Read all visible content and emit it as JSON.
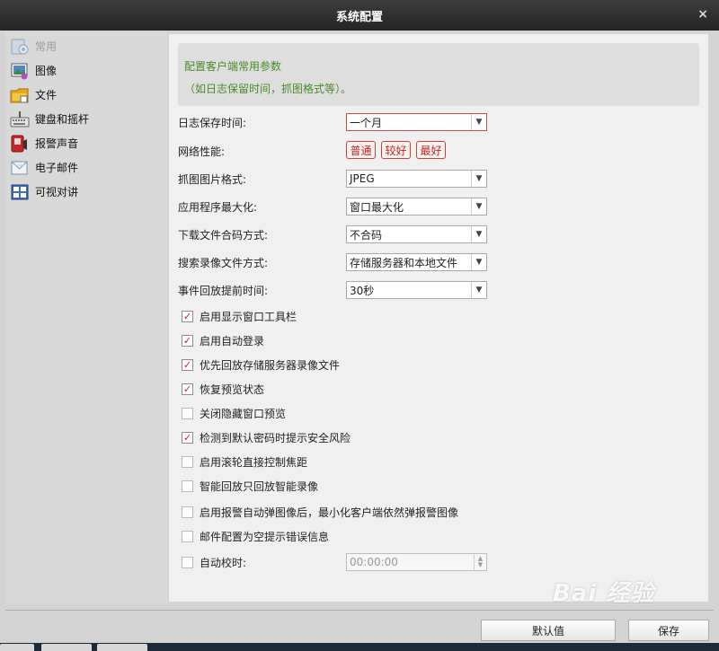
{
  "window": {
    "title": "系统配置",
    "close_icon": "×"
  },
  "sidebar": {
    "items": [
      {
        "label": "常用",
        "icon": "settings-icon",
        "active": true
      },
      {
        "label": "图像",
        "icon": "image-icon"
      },
      {
        "label": "文件",
        "icon": "folder-icon"
      },
      {
        "label": "键盘和摇杆",
        "icon": "keyboard-icon"
      },
      {
        "label": "报警声音",
        "icon": "alarm-sound-icon"
      },
      {
        "label": "电子邮件",
        "icon": "email-icon"
      },
      {
        "label": "可视对讲",
        "icon": "intercom-icon"
      }
    ]
  },
  "info": {
    "line1": "配置客户端常用参数",
    "line2": "（如日志保留时间，抓图格式等）。"
  },
  "settings": {
    "log_retention": {
      "label": "日志保存时间:",
      "value": "一个月"
    },
    "network": {
      "label": "网络性能:",
      "options": [
        "普通",
        "较好",
        "最好"
      ]
    },
    "capture_format": {
      "label": "抓图图片格式:",
      "value": "JPEG"
    },
    "app_maximize": {
      "label": "应用程序最大化:",
      "value": "窗口最大化"
    },
    "download_merge": {
      "label": "下载文件合码方式:",
      "value": "不合码"
    },
    "search_record": {
      "label": "搜索录像文件方式:",
      "value": "存储服务器和本地文件"
    },
    "event_playback": {
      "label": "事件回放提前时间:",
      "value": "30秒"
    }
  },
  "checkboxes": [
    {
      "label": "启用显示窗口工具栏",
      "checked": true
    },
    {
      "label": "启用自动登录",
      "checked": true
    },
    {
      "label": "优先回放存储服务器录像文件",
      "checked": true
    },
    {
      "label": "恢复预览状态",
      "checked": true
    },
    {
      "label": "关闭隐藏窗口预览",
      "checked": false
    },
    {
      "label": "检测到默认密码时提示安全风险",
      "checked": true
    },
    {
      "label": "启用滚轮直接控制焦距",
      "checked": false
    },
    {
      "label": "智能回放只回放智能录像",
      "checked": false
    },
    {
      "label": "启用报警自动弹图像后，最小化客户端依然弹报警图像",
      "checked": false
    },
    {
      "label": "邮件配置为空提示错误信息",
      "checked": false
    },
    {
      "label": "自动校时:",
      "checked": false
    }
  ],
  "auto_time": {
    "value": "00:00:00"
  },
  "footer": {
    "default_label": "默认值",
    "save_label": "保存"
  },
  "watermark": "Bai 经验",
  "colors": {
    "accent_red": "#c42222",
    "info_green": "#4a8a2a",
    "titlebar": "#2e2e2e"
  }
}
